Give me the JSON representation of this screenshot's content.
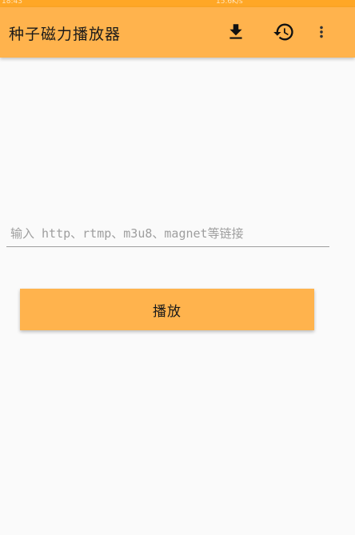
{
  "status_bar": {
    "time": "18:43",
    "right": "15.6K/s",
    "background": "#ffa726"
  },
  "app_bar": {
    "title": "种子磁力播放器",
    "background": "#ffb34d",
    "actions": [
      {
        "icon": "download-icon"
      },
      {
        "icon": "history-icon"
      },
      {
        "icon": "more-vert-icon"
      }
    ]
  },
  "input": {
    "value": "",
    "placeholder": "输入 http、rtmp、m3u8、magnet等链接"
  },
  "play_button": {
    "label": "播放",
    "background": "#ffb34d"
  }
}
